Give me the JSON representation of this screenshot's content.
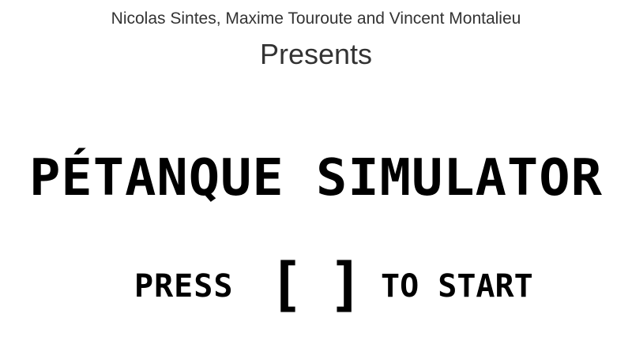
{
  "header": {
    "credits": "Nicolas Sintes, Maxime Touroute and Vincent Montalieu",
    "presents": "Presents"
  },
  "game": {
    "title": "PÉTANQUE SIMULATOR"
  },
  "prompt": {
    "press": "PRESS",
    "bracket_left": "[",
    "key": "",
    "bracket_right": "]",
    "to_start": "TO START"
  }
}
